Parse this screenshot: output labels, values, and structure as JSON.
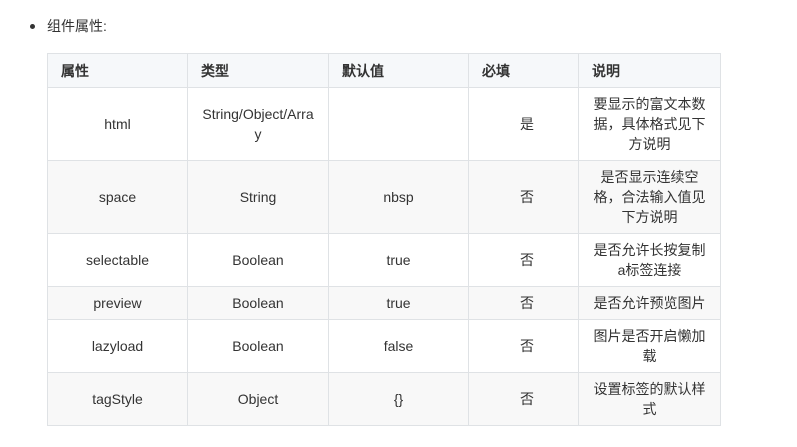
{
  "bullet": {
    "text": "组件属性:"
  },
  "table": {
    "headers": [
      "属性",
      "类型",
      "默认值",
      "必填",
      "说明"
    ],
    "rows": [
      {
        "name": "html",
        "type": "String/Object/Array",
        "default": "",
        "required": "是",
        "desc": "要显示的富文本数据，具体格式见下方说明"
      },
      {
        "name": "space",
        "type": "String",
        "default": "nbsp",
        "required": "否",
        "desc": "是否显示连续空格，合法输入值见下方说明"
      },
      {
        "name": "selectable",
        "type": "Boolean",
        "default": "true",
        "required": "否",
        "desc": "是否允许长按复制a标签连接"
      },
      {
        "name": "preview",
        "type": "Boolean",
        "default": "true",
        "required": "否",
        "desc": "是否允许预览图片"
      },
      {
        "name": "lazyload",
        "type": "Boolean",
        "default": "false",
        "required": "否",
        "desc": "图片是否开启懒加载"
      },
      {
        "name": "tagStyle",
        "type": "Object",
        "default": "{}",
        "required": "否",
        "desc": "设置标签的默认样式"
      }
    ]
  }
}
